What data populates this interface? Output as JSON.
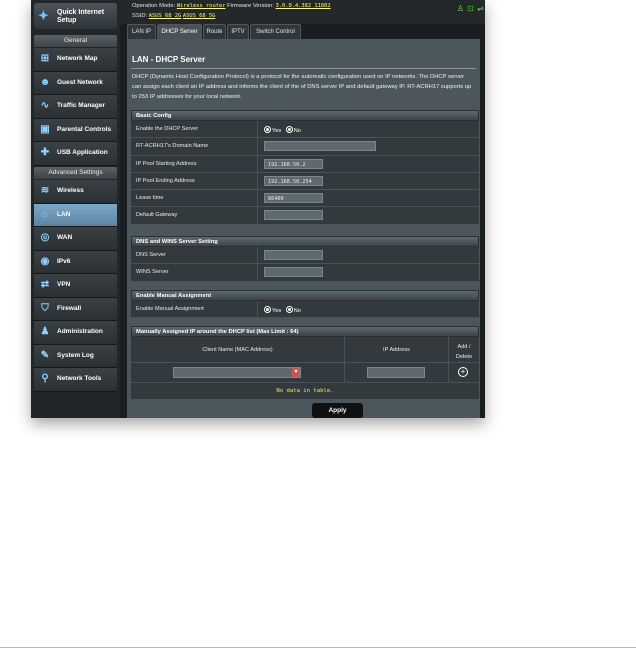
{
  "topbar": {
    "op_mode_label": "Operation Mode:",
    "op_mode_value": "Wireless router",
    "fw_label": "Firmware Version:",
    "fw_value": "3.0.0.4.382_11802",
    "ssid_label": "SSID:",
    "ssid_values": [
      "ASUS 68 2G",
      "ASUS 68 5G"
    ],
    "status_icons": [
      "user-status-icon",
      "network-status-icon",
      "usb-icon"
    ]
  },
  "sidebar": {
    "qis_label": "Quick Internet Setup",
    "general_header": "General",
    "general_items": [
      {
        "label": "Network Map",
        "icon": "network-map-icon"
      },
      {
        "label": "Guest Network",
        "icon": "guest-network-icon"
      },
      {
        "label": "Traffic Manager",
        "icon": "traffic-manager-icon"
      },
      {
        "label": "Parental Controls",
        "icon": "parental-controls-icon"
      },
      {
        "label": "USB Application",
        "icon": "usb-application-icon"
      }
    ],
    "advanced_header": "Advanced Settings",
    "advanced_items": [
      {
        "label": "Wireless",
        "icon": "wireless-icon"
      },
      {
        "label": "LAN",
        "icon": "lan-icon",
        "active": true
      },
      {
        "label": "WAN",
        "icon": "wan-icon"
      },
      {
        "label": "IPv6",
        "icon": "ipv6-icon"
      },
      {
        "label": "VPN",
        "icon": "vpn-icon"
      },
      {
        "label": "Firewall",
        "icon": "firewall-icon"
      },
      {
        "label": "Administration",
        "icon": "administration-icon"
      },
      {
        "label": "System Log",
        "icon": "system-log-icon"
      },
      {
        "label": "Network Tools",
        "icon": "network-tools-icon"
      }
    ]
  },
  "tabs": [
    "LAN IP",
    "DHCP Server",
    "Route",
    "IPTV",
    "Switch Control"
  ],
  "active_tab": "DHCP Server",
  "page": {
    "title": "LAN - DHCP Server",
    "description": "DHCP (Dynamic Host Configuration Protocol) is a protocol for the automatic configuration used on IP networks. The DHCP server can assign each client an IP address and informs the client of the of DNS server IP and default gateway IP. RT-ACRH17 supports up to 253 IP addresses for your local network."
  },
  "basic_config": {
    "header": "Basic Config",
    "enable_label": "Enable the DHCP Server",
    "yes": "Yes",
    "no": "No",
    "enable_value": "Yes",
    "domain_label": "RT-ACRH17's Domain Name",
    "domain_value": "",
    "start_label": "IP Pool Starting Address",
    "start_value": "192.168.50.2",
    "end_label": "IP Pool Ending Address",
    "end_value": "192.168.50.254",
    "lease_label": "Lease time",
    "lease_value": "86400",
    "gateway_label": "Default Gateway",
    "gateway_value": ""
  },
  "dns_wins": {
    "header": "DNS and WINS Server Setting",
    "dns_label": "DNS Server",
    "dns_value": "",
    "wins_label": "WINS Server",
    "wins_value": ""
  },
  "manual": {
    "header": "Enable Manual Assignment",
    "label": "Enable Manual Assignment",
    "yes": "Yes",
    "no": "No",
    "value": "Yes"
  },
  "manual_list": {
    "header": "Manually Assigned IP around the DHCP list (Max Limit : 64)",
    "col_client": "Client Name (MAC Address)",
    "col_ip": "IP Address",
    "col_add": "Add / Delete",
    "no_data": "No data in table."
  },
  "apply_label": "Apply"
}
